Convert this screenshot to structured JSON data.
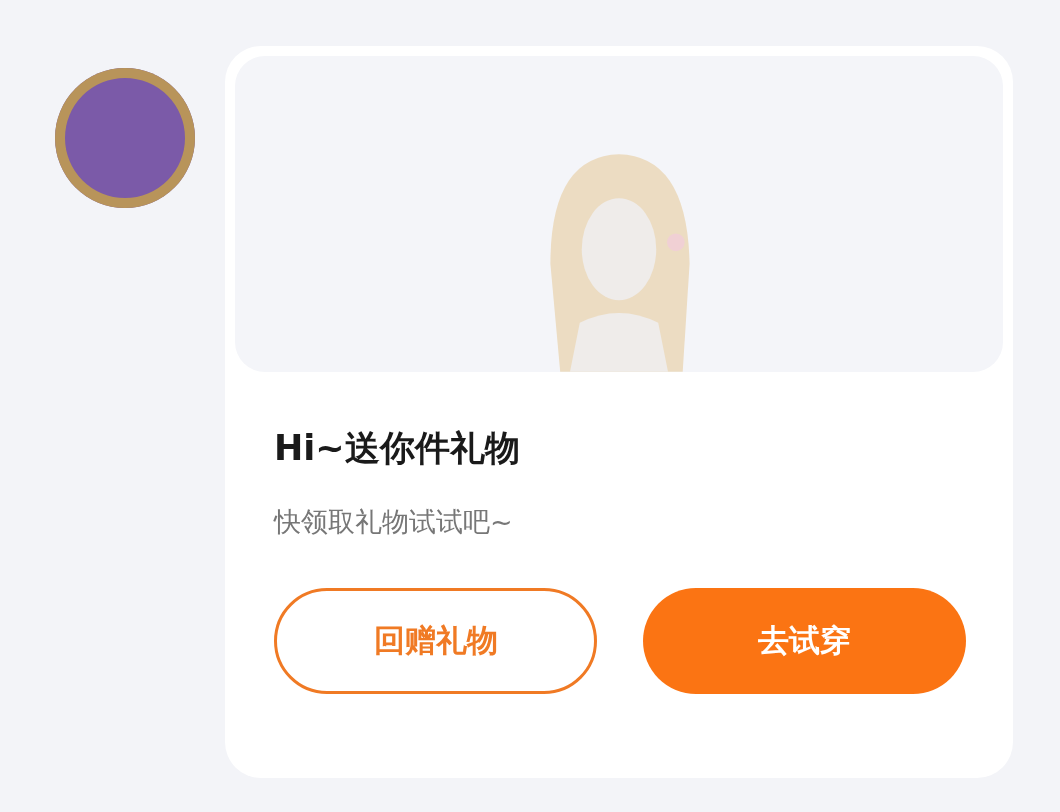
{
  "message": {
    "title": "Hi~送你件礼物",
    "subtitle": "快领取礼物试试吧~"
  },
  "buttons": [
    {
      "label": "回赠礼物",
      "kind": "outline"
    },
    {
      "label": "去试穿",
      "kind": "filled"
    }
  ]
}
